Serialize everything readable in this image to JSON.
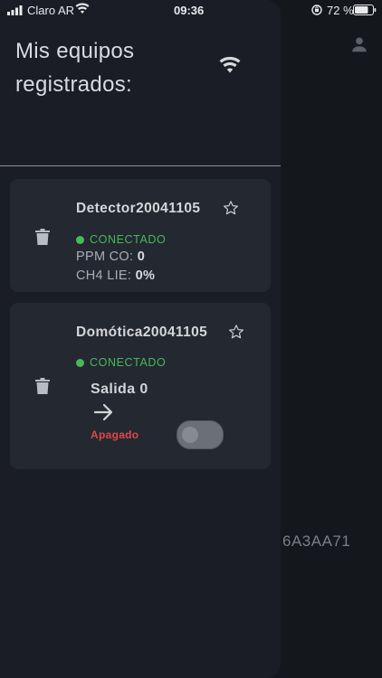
{
  "status_bar": {
    "carrier": "Claro AR",
    "time": "09:36",
    "battery_pct": "72 %"
  },
  "background": {
    "partial_text": "6A3AA71"
  },
  "drawer": {
    "title": "Mis equipos registrados:",
    "devices": [
      {
        "name": "Detector20041105",
        "status": "CONECTADO",
        "readings": [
          {
            "label": "PPM CO:",
            "value": "0"
          },
          {
            "label": "CH4 LIE:",
            "value": "0%"
          }
        ]
      },
      {
        "name": "Domótica20041105",
        "status": "CONECTADO",
        "output_label": "Salida 0",
        "state_label": "Apagado",
        "toggle_on": false
      }
    ]
  },
  "colors": {
    "connected": "#48b85a",
    "off": "#e04848"
  }
}
